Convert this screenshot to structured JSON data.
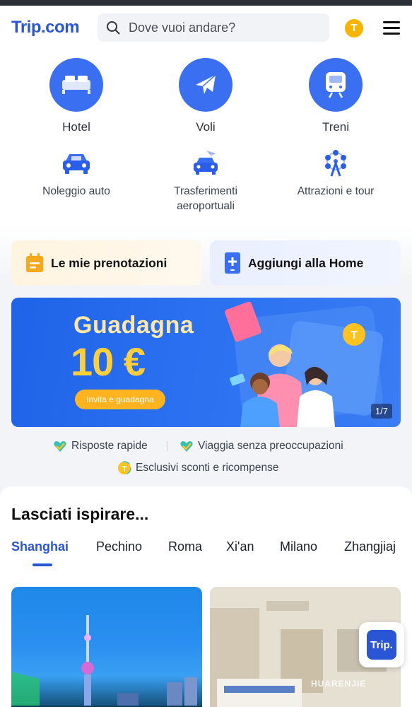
{
  "header": {
    "logo_text": "Trip",
    "logo_suffix": ".com",
    "search_placeholder": "Dove vuoi andare?",
    "coin_label": "T"
  },
  "services": {
    "primary": [
      {
        "label": "Hotel",
        "icon": "bed-icon"
      },
      {
        "label": "Voli",
        "icon": "airplane-icon"
      },
      {
        "label": "Treni",
        "icon": "train-icon"
      }
    ],
    "secondary": [
      {
        "label": "Noleggio auto",
        "icon": "car-icon"
      },
      {
        "label": "Trasferimenti aeroportuali",
        "icon": "airport-transfer-icon"
      },
      {
        "label": "Attrazioni e tour",
        "icon": "ferris-wheel-icon"
      }
    ]
  },
  "quick_actions": {
    "bookings_label": "Le mie prenotazioni",
    "add_home_label": "Aggiungi alla Home"
  },
  "banner": {
    "title": "Guadagna",
    "amount": "10 €",
    "cta": "Invita e guadagna",
    "page_indicator": "1/7"
  },
  "perks": {
    "fast": "Risposte rapide",
    "worry_free": "Viaggia senza preoccupazioni",
    "exclusive": "Esclusivi sconti e ricompense"
  },
  "inspire": {
    "title": "Lasciati ispirare...",
    "tabs": [
      "Shanghai",
      "Pechino",
      "Roma",
      "Xi'an",
      "Milano",
      "Zhangjiaj"
    ],
    "active_tab": "Shanghai"
  },
  "fab": {
    "label": "Trip."
  },
  "watermark": "HUARENJIE",
  "colors": {
    "brand_blue": "#2a56d6",
    "service_blue": "#3a6ff2",
    "coin_yellow": "#f7b500"
  }
}
